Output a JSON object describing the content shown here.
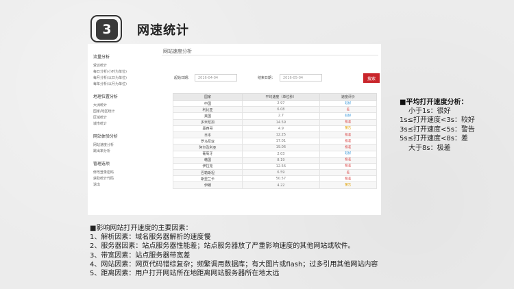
{
  "slide": {
    "number": "3",
    "title": "网速统计"
  },
  "sidebar": {
    "groups": [
      {
        "head": "流量分析",
        "items": [
          "受访统计",
          "每日分析(小时为单位)",
          "每月分析(以日为单位)",
          "每年分析(以月为单位)"
        ]
      },
      {
        "head": "地理位置分析",
        "items": [
          "大洲统计",
          "国家/地区统计",
          "区域统计",
          "城市统计"
        ]
      },
      {
        "head": "网站体验分析",
        "items": [
          "网站速度分析",
          "跳出率分析"
        ]
      },
      {
        "head": "管理选项",
        "items": [
          "修改登录密码",
          "获取统计代码",
          "退出"
        ]
      }
    ]
  },
  "main": {
    "title": "网站速度分析",
    "filter": {
      "start_label": "起始日期：",
      "start_value": "2016-04-04",
      "end_label": "结束日期：",
      "end_value": "2016-05-04",
      "search_label": "搜索"
    },
    "table": {
      "headers": [
        "国家",
        "平均速度（单位秒）",
        "速度评价"
      ],
      "rows": [
        {
          "country": "中国",
          "speed": "2.97",
          "rating": "较好"
        },
        {
          "country": "利比亚",
          "speed": "6.08",
          "rating": "差"
        },
        {
          "country": "美国",
          "speed": "2.7",
          "rating": "较好"
        },
        {
          "country": "多米尼加",
          "speed": "14.59",
          "rating": "极差"
        },
        {
          "country": "墨西哥",
          "speed": "4.9",
          "rating": "警告"
        },
        {
          "country": "日本",
          "speed": "12.25",
          "rating": "极差"
        },
        {
          "country": "罗马尼亚",
          "speed": "17.01",
          "rating": "极差"
        },
        {
          "country": "阿尔及利亚",
          "speed": "19.06",
          "rating": "极差"
        },
        {
          "country": "葡萄牙",
          "speed": "2.03",
          "rating": "较好"
        },
        {
          "country": "韩国",
          "speed": "8.19",
          "rating": "极差"
        },
        {
          "country": "伊拉克",
          "speed": "12.56",
          "rating": "极差"
        },
        {
          "country": "巴勒斯坦",
          "speed": "6.59",
          "rating": "差"
        },
        {
          "country": "斯里兰卡",
          "speed": "50.57",
          "rating": "极差"
        },
        {
          "country": "伊朗",
          "speed": "4.22",
          "rating": "警告"
        }
      ]
    }
  },
  "analysis": {
    "title": "■平均打开速度分析：",
    "lines": [
      "小于1s：很好",
      "1s≤打开速度<3s：较好",
      "3s≤打开速度<5s：警告",
      "5s≤打开速度<8s：差",
      "大于8s：极差"
    ]
  },
  "factors": {
    "title": "■影响网站打开速度的主要因素：",
    "lines": [
      "1、解析因素：域名服务器解析的速度慢",
      "2、服务器因素：站点服务器性能差；站点服务器放了严重影响速度的其他网站或软件。",
      "3、带宽因素：站点服务器带宽差",
      "4、网站因素：网页代码错综复杂；频繁调用数据库；有大图片或flash；过多引用其他网站内容",
      "5、距离因素：用户打开网站所在地距离网站服务器所在地太远"
    ]
  }
}
